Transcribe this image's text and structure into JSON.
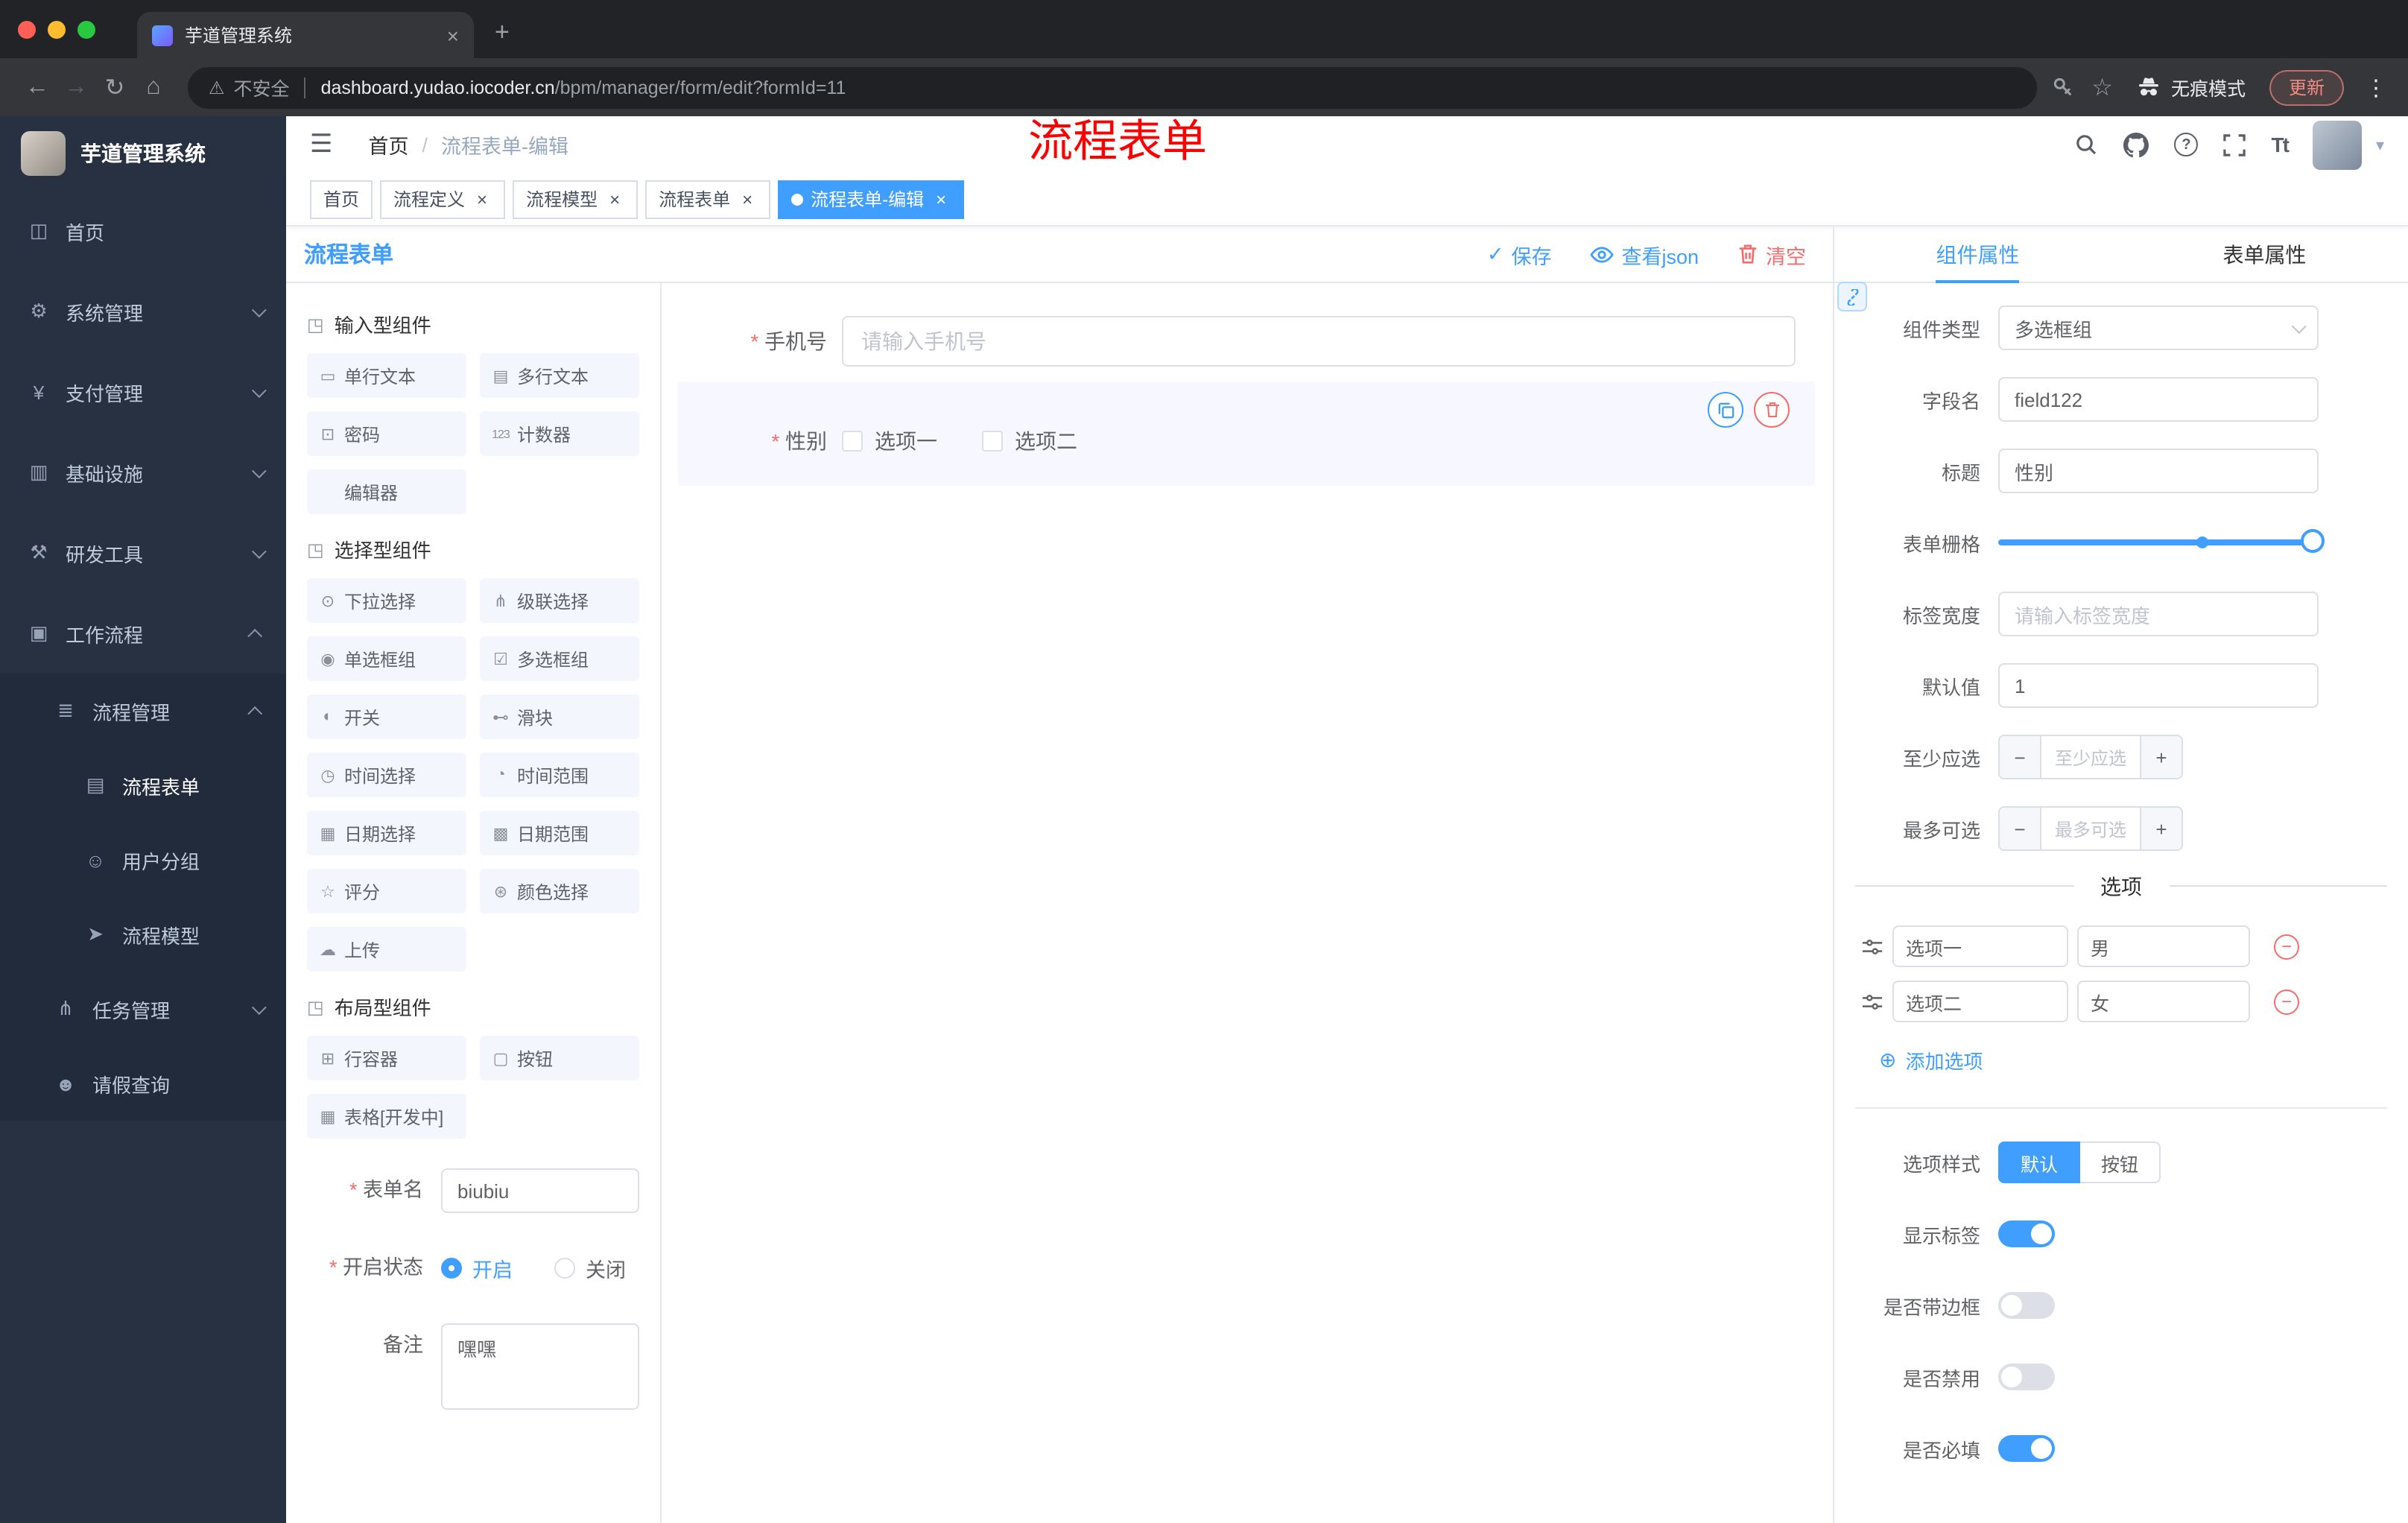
{
  "annotation": "流程表单",
  "browser": {
    "tab_title": "芋道管理系统",
    "security_label": "不安全",
    "url_host": "dashboard.yudao.iocoder.cn",
    "url_path": "/bpm/manager/form/edit?formId=11",
    "incognito_label": "无痕模式",
    "update_label": "更新"
  },
  "glyphs": {
    "back": "←",
    "forward": "→",
    "reload": "↻",
    "home": "⌂",
    "warning": "⚠",
    "star": "☆",
    "plus": "+",
    "close": "×",
    "ellipsis": "⋮",
    "hamburger": "☰",
    "check": "✓",
    "minus": "−",
    "plus_sign": "+",
    "add_circle": "⊕",
    "question": "?",
    "font_size": "Tt",
    "caret": "▾"
  },
  "navbar": {
    "breadcrumb_home": "首页",
    "breadcrumb_sep": "/",
    "breadcrumb_current": "流程表单-编辑"
  },
  "sidebar": {
    "logo_title": "芋道管理系统",
    "items": [
      {
        "glyph": "◫",
        "label": "首页"
      },
      {
        "glyph": "⚙",
        "label": "系统管理"
      },
      {
        "glyph": "¥",
        "label": "支付管理"
      },
      {
        "glyph": "▥",
        "label": "基础设施"
      },
      {
        "glyph": "⚒",
        "label": "研发工具"
      },
      {
        "glyph": "▣",
        "label": "工作流程"
      },
      {
        "glyph": "≣",
        "label": "流程管理"
      },
      {
        "glyph": "▤",
        "label": "流程表单"
      },
      {
        "glyph": "☺",
        "label": "用户分组"
      },
      {
        "glyph": "➤",
        "label": "流程模型"
      },
      {
        "glyph": "⋔",
        "label": "任务管理"
      },
      {
        "glyph": "☻",
        "label": "请假查询"
      }
    ]
  },
  "tags": [
    {
      "label": "首页"
    },
    {
      "label": "流程定义"
    },
    {
      "label": "流程模型"
    },
    {
      "label": "流程表单"
    },
    {
      "label": "流程表单-编辑"
    }
  ],
  "designer": {
    "title": "流程表单",
    "save": "保存",
    "view_json": "查看json",
    "clear": "清空",
    "groups": [
      {
        "title": "输入型组件",
        "items": [
          {
            "glyph": "▭",
            "label": "单行文本"
          },
          {
            "glyph": "▤",
            "label": "多行文本"
          },
          {
            "glyph": "⊡",
            "label": "密码"
          },
          {
            "glyph": "123",
            "label": "计数器"
          },
          {
            "glyph": "",
            "label": "编辑器"
          }
        ]
      },
      {
        "title": "选择型组件",
        "items": [
          {
            "glyph": "⊙",
            "label": "下拉选择"
          },
          {
            "glyph": "⋔",
            "label": "级联选择"
          },
          {
            "glyph": "◉",
            "label": "单选框组"
          },
          {
            "glyph": "☑",
            "label": "多选框组"
          },
          {
            "glyph": "◐",
            "label": "开关"
          },
          {
            "glyph": "⊷",
            "label": "滑块"
          },
          {
            "glyph": "◷",
            "label": "时间选择"
          },
          {
            "glyph": "◔",
            "label": "时间范围"
          },
          {
            "glyph": "▦",
            "label": "日期选择"
          },
          {
            "glyph": "▩",
            "label": "日期范围"
          },
          {
            "glyph": "☆",
            "label": "评分"
          },
          {
            "glyph": "⊛",
            "label": "颜色选择"
          },
          {
            "glyph": "☁",
            "label": "上传"
          }
        ]
      },
      {
        "title": "布局型组件",
        "items": [
          {
            "glyph": "⊞",
            "label": "行容器"
          },
          {
            "glyph": "▢",
            "label": "按钮"
          },
          {
            "glyph": "▦",
            "label": "表格[开发中]"
          }
        ]
      }
    ],
    "meta": {
      "form_name_label": "表单名",
      "form_name_value": "biubiu",
      "status_label": "开启状态",
      "status_on": "开启",
      "status_off": "关闭",
      "remark_label": "备注",
      "remark_value": "嘿嘿"
    },
    "canvas": {
      "phone_label": "手机号",
      "phone_placeholder": "请输入手机号",
      "gender_label": "性别",
      "gender_options": [
        "选项一",
        "选项二"
      ]
    }
  },
  "panel": {
    "tab_component": "组件属性",
    "tab_form": "表单属性",
    "rows": {
      "type_label": "组件类型",
      "type_value": "多选框组",
      "field_label": "字段名",
      "field_value": "field122",
      "title_label": "标题",
      "title_value": "性别",
      "grid_label": "表单栅格",
      "width_label": "标签宽度",
      "width_placeholder": "请输入标签宽度",
      "default_label": "默认值",
      "default_value": "1",
      "min_label": "至少应选",
      "min_placeholder": "至少应选",
      "max_label": "最多可选",
      "max_placeholder": "最多可选"
    },
    "options": {
      "divider": "选项",
      "rows": [
        {
          "name": "选项一",
          "value": "男"
        },
        {
          "name": "选项二",
          "value": "女"
        }
      ],
      "add_label": "添加选项"
    },
    "style": {
      "style_label": "选项样式",
      "style_default": "默认",
      "style_button": "按钮",
      "toggle_show_label": "显示标签",
      "toggle_border": "是否带边框",
      "toggle_disabled": "是否禁用",
      "toggle_required": "是否必填"
    }
  },
  "colors": {
    "primary": "#409eff",
    "danger": "#f56c6c",
    "annotation": "#ff0000",
    "sidebar_bg": "#273142",
    "sidebar_submenu_bg": "#212b3b"
  }
}
